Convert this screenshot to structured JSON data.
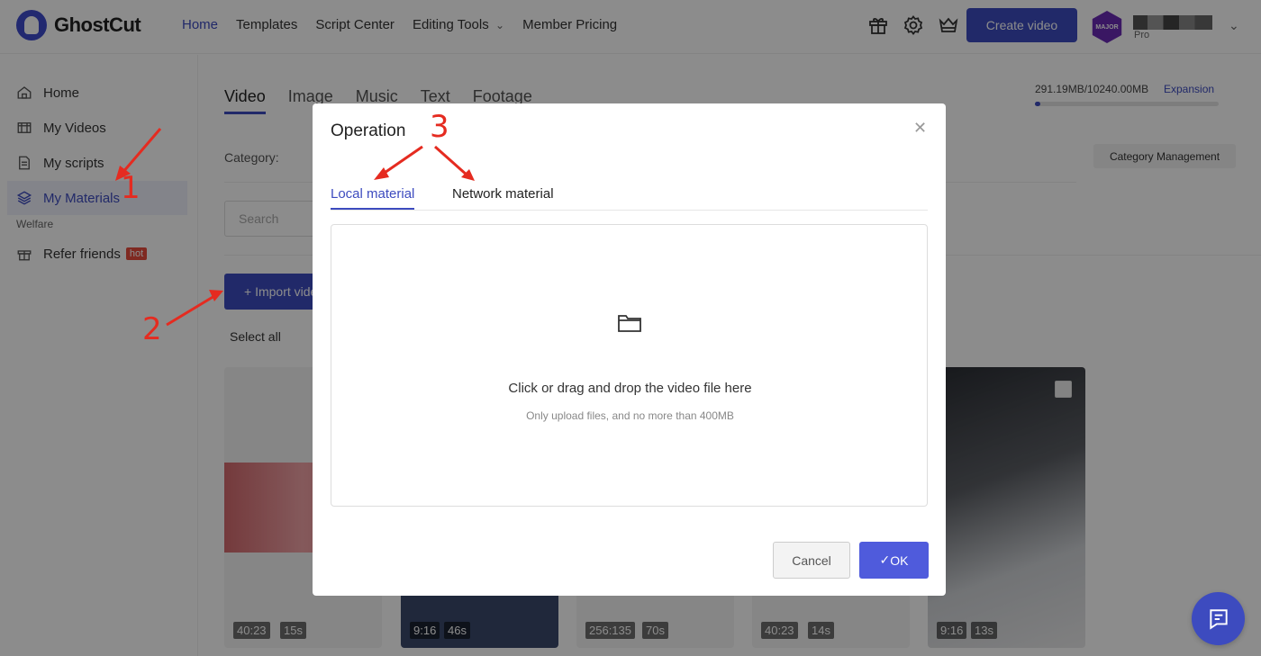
{
  "header": {
    "logo_text": "GhostCut",
    "nav": [
      {
        "label": "Home"
      },
      {
        "label": "Templates"
      },
      {
        "label": "Script Center"
      },
      {
        "label": "Editing Tools"
      },
      {
        "label": "Member Pricing"
      }
    ],
    "create_video_label": "Create video",
    "avatar_badge": "MAJOR",
    "plan_label": "Pro",
    "icons": [
      "gift-icon",
      "settings-icon",
      "crown-icon"
    ]
  },
  "sidebar": {
    "items": [
      {
        "label": "Home",
        "icon": "home-icon"
      },
      {
        "label": "My Videos",
        "icon": "videos-icon"
      },
      {
        "label": "My scripts",
        "icon": "script-icon"
      },
      {
        "label": "My Materials",
        "icon": "layers-icon"
      }
    ],
    "section_label": "Welfare",
    "refer": {
      "label": "Refer friends",
      "badge": "hot",
      "icon": "gift-icon"
    }
  },
  "main": {
    "tabs": [
      {
        "label": "Video"
      },
      {
        "label": "Image"
      },
      {
        "label": "Music"
      },
      {
        "label": "Text"
      },
      {
        "label": "Footage"
      }
    ],
    "storage_text": "291.19MB/10240.00MB",
    "storage_fraction": 0.028,
    "expansion_label": "Expansion",
    "category_label": "Category:",
    "category_mgmt_label": "Category Management",
    "search_placeholder": "Search",
    "import_label": "+ Import video",
    "select_all_label": "Select all",
    "cards": [
      {
        "ratio": "40:23",
        "duration": "15s"
      },
      {
        "ratio": "9:16",
        "duration": "46s"
      },
      {
        "ratio": "256:135",
        "duration": "70s"
      },
      {
        "ratio": "40:23",
        "duration": "14s"
      },
      {
        "ratio": "9:16",
        "duration": "13s"
      }
    ]
  },
  "modal": {
    "title": "Operation",
    "tabs": [
      {
        "label": "Local material"
      },
      {
        "label": "Network material"
      }
    ],
    "drop_main": "Click or drag and drop the video file here",
    "drop_sub": "Only upload files, and no more than 400MB",
    "cancel_label": "Cancel",
    "ok_label": "OK"
  },
  "annotations": [
    "1",
    "2",
    "3"
  ],
  "colors": {
    "accent": "#3d4bbf",
    "annotation": "#e52b20"
  }
}
